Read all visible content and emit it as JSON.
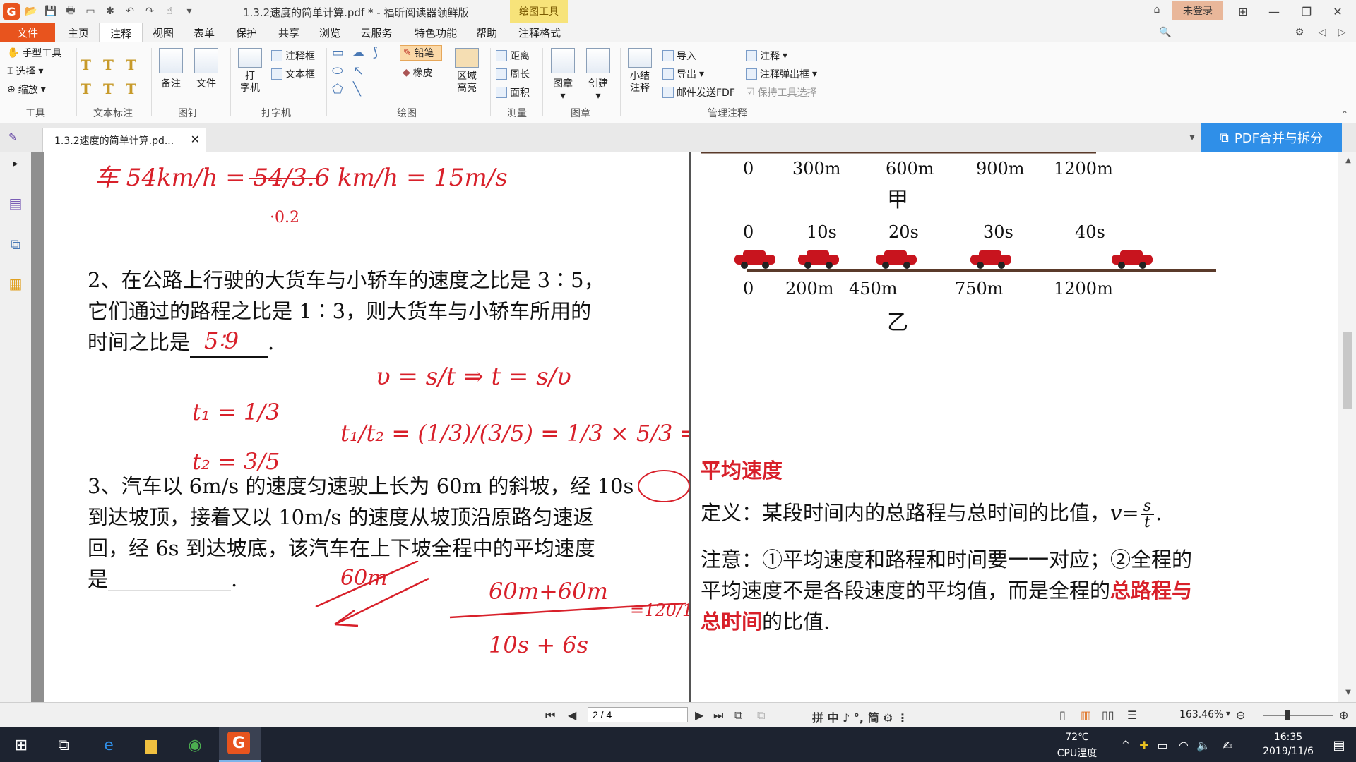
{
  "titlebar": {
    "title": "1.3.2速度的简单计算.pdf * - 福昕阅读器领鲜版",
    "context_tab": "绘图工具",
    "login": "未登录"
  },
  "menu": {
    "tabs": [
      "文件",
      "主页",
      "注释",
      "视图",
      "表单",
      "保护",
      "共享",
      "浏览",
      "云服务",
      "特色功能",
      "帮助",
      "注释格式"
    ],
    "active": "注释",
    "search_placeholder": "查找"
  },
  "ribbon": {
    "tools": {
      "hand": "手型工具",
      "select": "选择",
      "zoom": "缩放",
      "label": "工具"
    },
    "text_markup": {
      "label": "文本标注"
    },
    "pin": {
      "note": "备注",
      "file": "文件",
      "label": "图钉"
    },
    "typewriter": {
      "big": "打\n字机",
      "callout": "注释框",
      "textbox": "文本框",
      "label": "打字机"
    },
    "drawing": {
      "pencil": "铅笔",
      "eraser": "橡皮",
      "area_highlight": "区域\n高亮",
      "label": "绘图"
    },
    "measure": {
      "distance": "距离",
      "perimeter": "周长",
      "area": "面积",
      "label": "测量"
    },
    "stamp": {
      "stamp": "图章",
      "create": "创建",
      "label": "图章"
    },
    "manage": {
      "summary": "小结\n注释",
      "import": "导入",
      "export": "导出",
      "email": "邮件发送FDF",
      "annotate": "注释",
      "popup": "注释弹出框",
      "keep_tool": "保持工具选择",
      "label": "管理注释"
    }
  },
  "doc_tab": {
    "name": "1.3.2速度的简单计算.pd..."
  },
  "pdf_merge": "PDF合并与拆分",
  "page": {
    "handwritten_top": "车  54km/h = 54/3.6 km/h = 15m/s",
    "q2": {
      "line1": "2、在公路上行驶的大货车与小轿车的速度之比是 3∶5，",
      "line2": "它们通过的路程之比是 1∶3，则大货车与小轿车所用的",
      "line3_prefix": "时间之比是",
      "line3_suffix": "."
    },
    "q2_answer": "5∶9",
    "q3": {
      "line1": "3、汽车以 6m/s 的速度匀速驶上长为 60m 的斜坡，经 10s",
      "line2": "到达坡顶，接着又以 10m/s 的速度从坡顶沿原路匀速返",
      "line3": "回，经 6s 到达坡底，该汽车在上下坡全程中的平均速度",
      "line4": "是____________."
    },
    "diagram": {
      "top_ticks": [
        "0",
        "300m",
        "600m",
        "900m",
        "1200m"
      ],
      "label_jia": "甲",
      "time_ticks": [
        "0",
        "10s",
        "20s",
        "30s",
        "40s"
      ],
      "bottom_ticks": [
        "0",
        "200m",
        "450m",
        "750m",
        "1200m"
      ],
      "label_yi": "乙"
    },
    "avg_speed": {
      "title": "平均速度",
      "def_prefix": "定义：某段时间内的总路程与总时间的比值，",
      "formula_v": "v",
      "formula_eq": "=",
      "formula_s": "s",
      "formula_t": "t",
      "def_suffix": ".",
      "note_line1": "注意：①平均速度和路程和时间要一一对应；②全程的",
      "note_line2_prefix": "平均速度不是各段速度的平均值，而是全程的",
      "note_line2_red": "总路程与",
      "note_line3_red": "总时间",
      "note_line3_suffix": "的比值."
    }
  },
  "statusbar": {
    "page": "2 / 4",
    "zoom": "163.46%"
  },
  "taskbar": {
    "temp": "72℃",
    "temp_label": "CPU温度",
    "time": "16:35",
    "date": "2019/11/6"
  },
  "colors": {
    "accent": "#e8541e",
    "ink": "#d8202a",
    "blue": "#2f8fe8"
  }
}
